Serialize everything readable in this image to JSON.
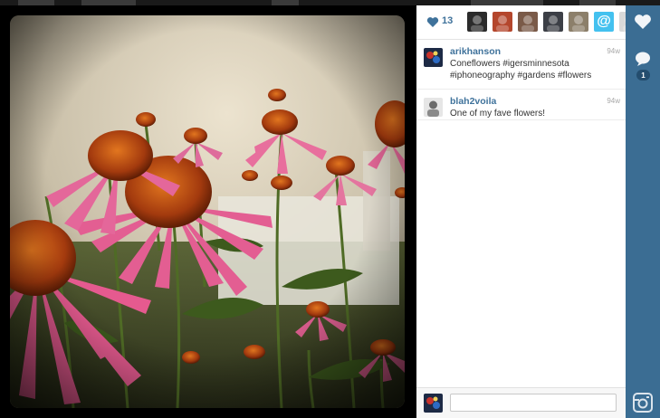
{
  "photo": {
    "subject": "pink coneflowers"
  },
  "likes": {
    "count": "13",
    "likers": [
      {
        "name": "liker-1",
        "color": "#2b2b2b"
      },
      {
        "name": "liker-2",
        "color": "#b4462c"
      },
      {
        "name": "liker-3",
        "color": "#7a5a48"
      },
      {
        "name": "liker-4",
        "color": "#3c3f46"
      },
      {
        "name": "liker-5",
        "color": "#8c7f6a"
      },
      {
        "name": "liker-6",
        "color": "#44c1ef",
        "glyph": "@"
      },
      {
        "name": "liker-7",
        "color": "#d9d9d9"
      },
      {
        "name": "liker-8",
        "color": "#8b8b8b"
      }
    ]
  },
  "comments": [
    {
      "user": "arikhanson",
      "time": "94w",
      "text": "Coneflowers #igersminnesota #iphoneography #gardens #flowers"
    },
    {
      "user": "blah2voila",
      "time": "94w",
      "text": "One of my fave flowers!"
    }
  ],
  "composer": {
    "placeholder": ""
  },
  "rail": {
    "comment_badge": "1"
  },
  "colors": {
    "accent": "#3f729b",
    "rail": "#3b6d93"
  }
}
